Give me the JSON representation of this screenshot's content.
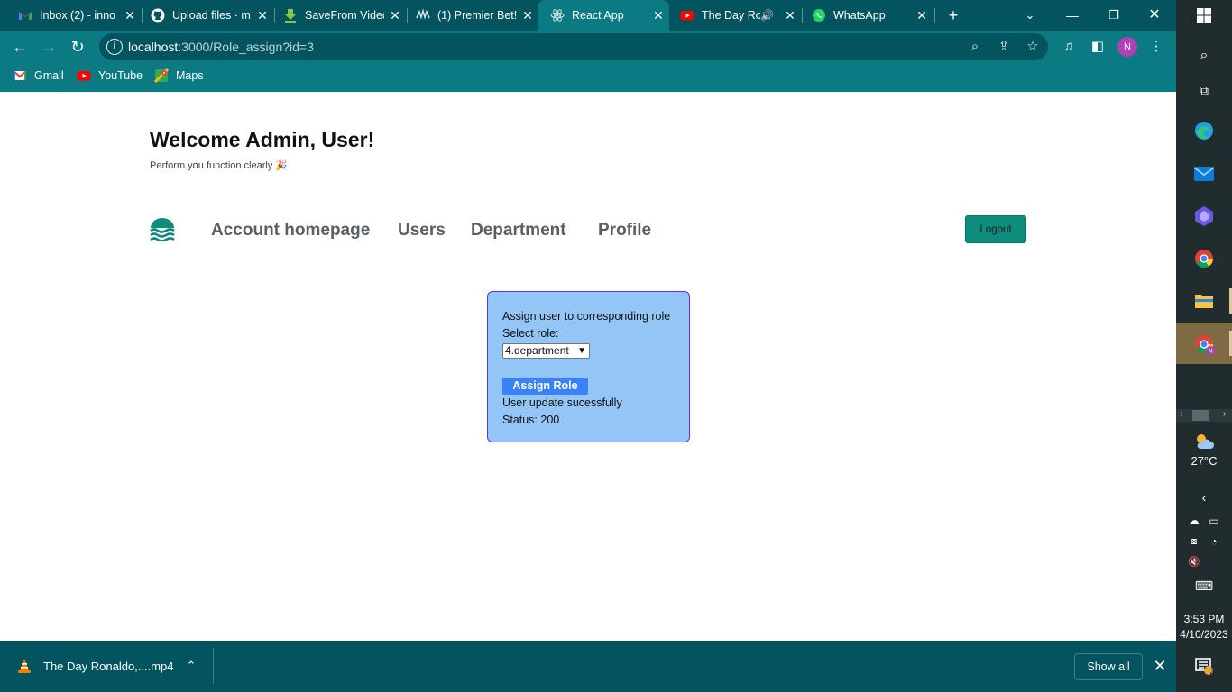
{
  "tabs": [
    {
      "title": "Inbox (2) - inno",
      "icon": "gmail-icon"
    },
    {
      "title": "Upload files · m",
      "icon": "github-icon"
    },
    {
      "title": "SaveFrom Video",
      "icon": "download-arrow-icon"
    },
    {
      "title": "(1) Premier Bet!",
      "icon": "premier-bet-icon"
    },
    {
      "title": "React App",
      "icon": "react-icon",
      "active": true
    },
    {
      "title": "The Day Ro",
      "icon": "youtube-icon"
    },
    {
      "title": "WhatsApp",
      "icon": "whatsapp-icon"
    }
  ],
  "address_bar": {
    "host": "localhost",
    "path": ":3000/Role_assign?id=3"
  },
  "bookmarks": [
    {
      "label": "Gmail",
      "icon": "gmail-icon"
    },
    {
      "label": "YouTube",
      "icon": "youtube-icon"
    },
    {
      "label": "Maps",
      "icon": "maps-icon"
    }
  ],
  "page": {
    "welcome": "Welcome Admin, User!",
    "subtitle": "Perform you function clearly 🎉",
    "nav": [
      "Account homepage",
      "Users",
      "Department",
      "Profile"
    ],
    "logout_label": "Logout",
    "card": {
      "heading": "Assign user to corresponding role",
      "select_label": "Select role:",
      "selected_role": "4.department",
      "assign_button": "Assign Role",
      "message": "User update sucessfully",
      "status": "Status: 200"
    }
  },
  "downloads": {
    "file": "The Day Ronaldo,....mp4",
    "show_all": "Show all"
  },
  "taskbar": {
    "temperature": "27°C",
    "time": "3:53 PM",
    "date": "4/10/2023",
    "notifications": "3"
  },
  "colors": {
    "chrome_dark": "#04545f",
    "chrome_light": "#0b7a83",
    "logout_bg": "#0e8c7c",
    "card_bg": "#93c5f6",
    "card_border": "#6a2ed8",
    "assign_btn": "#3b82f6"
  }
}
